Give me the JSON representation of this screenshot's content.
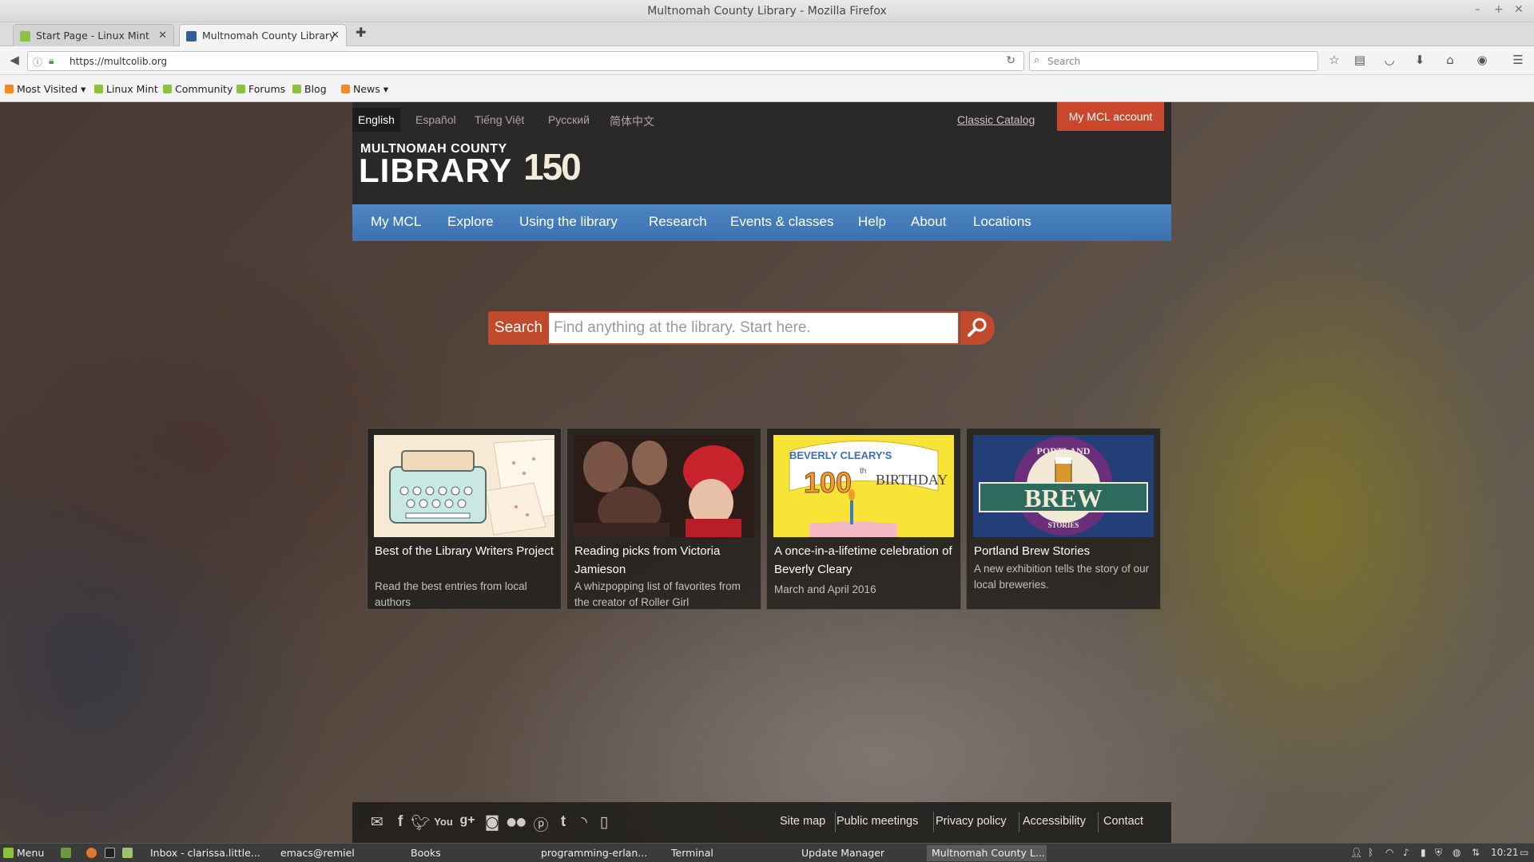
{
  "window": {
    "title": "Multnomah County Library - Mozilla Firefox"
  },
  "tabs": [
    {
      "label": "Start Page - Linux Mint",
      "active": false
    },
    {
      "label": "Multnomah County Library",
      "active": true
    }
  ],
  "navbar": {
    "url": "https://multcolib.org",
    "search_placeholder": "Search"
  },
  "bookmarks": [
    {
      "label": "Most Visited",
      "icon": "rss-icon"
    },
    {
      "label": "Linux Mint",
      "icon": "mint-icon"
    },
    {
      "label": "Community",
      "icon": "mint-icon"
    },
    {
      "label": "Forums",
      "icon": "mint-icon"
    },
    {
      "label": "Blog",
      "icon": "mint-icon"
    },
    {
      "label": "News",
      "icon": "rss-icon"
    }
  ],
  "header": {
    "languages": [
      "English",
      "Español",
      "Tiếng Việt",
      "Русский",
      "简体中文"
    ],
    "classic_catalog": "Classic Catalog",
    "account_button": "My MCL account",
    "logo_line1": "MULTNOMAH COUNTY",
    "logo_line2": "LIBRARY",
    "logo_badge": "150"
  },
  "nav": [
    "My MCL",
    "Explore",
    "Using the library",
    "Research",
    "Events & classes",
    "Help",
    "About",
    "Locations"
  ],
  "search": {
    "label": "Search",
    "placeholder": "Find anything at the library. Start here."
  },
  "cards": [
    {
      "title": "Best of the Library Writers Project",
      "desc": "Read the best entries from local authors"
    },
    {
      "title": "Reading picks from Victoria Jamieson",
      "desc": "A whizpopping list of favorites from the creator of Roller Girl"
    },
    {
      "title": "A once-in-a-lifetime celebration of Beverly Cleary",
      "desc": "March and April 2016",
      "thumb_text1": "BEVERLY CLEARY'S",
      "thumb_text2": "100",
      "thumb_text3": "th",
      "thumb_text4": "BIRTHDAY"
    },
    {
      "title": "Portland Brew Stories",
      "desc": "A new exhibition tells the story of our local breweries.",
      "thumb_text1": "PORTLAND",
      "thumb_text2": "BREW",
      "thumb_text3": "STORIES"
    }
  ],
  "footer": {
    "social_icons": [
      "email-icon",
      "facebook-icon",
      "twitter-icon",
      "youtube-icon",
      "google-plus-icon",
      "instagram-icon",
      "flickr-icon",
      "pinterest-icon",
      "tumblr-icon",
      "rss-icon",
      "mobile-icon"
    ],
    "links": [
      "Site map",
      "Public meetings",
      "Privacy policy",
      "Accessibility",
      "Contact"
    ]
  },
  "taskbar": {
    "menu": "Menu",
    "tasks": [
      {
        "label": "Inbox - clarissa.little...",
        "active": false
      },
      {
        "label": "emacs@remiel",
        "active": false
      },
      {
        "label": "Books",
        "active": false
      },
      {
        "label": "programming-erlan...",
        "active": false
      },
      {
        "label": "Terminal",
        "active": false
      },
      {
        "label": "Update Manager",
        "active": false
      },
      {
        "label": "Multnomah County L...",
        "active": true
      }
    ],
    "clock": "10:21"
  },
  "colors": {
    "accent_red": "#c24a2c",
    "nav_blue": "#4278b6",
    "header_dark": "#2b2927"
  }
}
